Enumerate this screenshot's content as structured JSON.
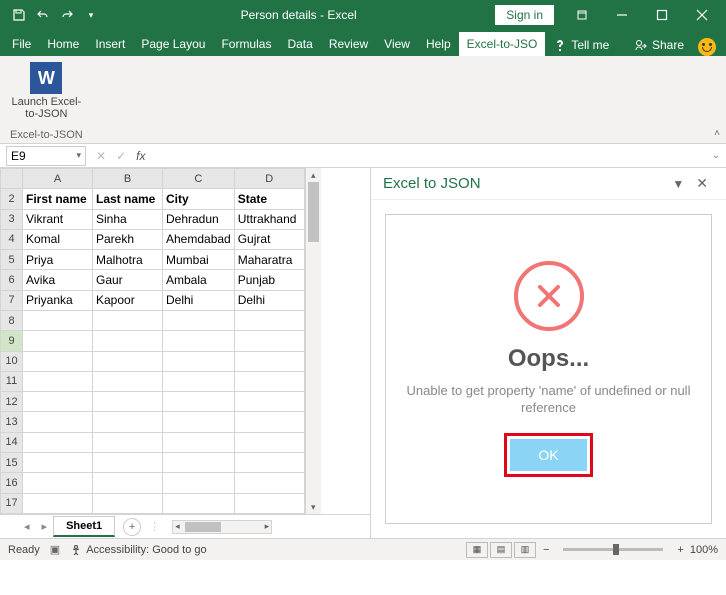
{
  "titlebar": {
    "title": "Person details - Excel",
    "signin": "Sign in"
  },
  "tabs": {
    "file": "File",
    "home": "Home",
    "insert": "Insert",
    "pagelayout": "Page Layou",
    "formulas": "Formulas",
    "data": "Data",
    "review": "Review",
    "view": "View",
    "help": "Help",
    "exceltojson": "Excel-to-JSO",
    "tellme": "Tell me",
    "share": "Share"
  },
  "ribbon": {
    "launch_label": "Launch Excel-\nto-JSON",
    "group_name": "Excel-to-JSON",
    "big_icon_letter": "W"
  },
  "namebox": "E9",
  "sheet": {
    "cols": [
      "A",
      "B",
      "C",
      "D"
    ],
    "rows": [
      "2",
      "3",
      "4",
      "5",
      "6",
      "7",
      "8",
      "9",
      "10",
      "11",
      "12",
      "13",
      "14",
      "15",
      "16",
      "17"
    ],
    "headers": [
      "First name",
      "Last name",
      "City",
      "State"
    ],
    "data": [
      [
        "Vikrant",
        "Sinha",
        "Dehradun",
        "Uttrakhand"
      ],
      [
        "Komal",
        "Parekh",
        "Ahemdabad",
        "Gujrat"
      ],
      [
        "Priya",
        "Malhotra",
        "Mumbai",
        "Maharatra"
      ],
      [
        "Avika",
        "Gaur",
        "Ambala",
        "Punjab"
      ],
      [
        "Priyanka",
        "Kapoor",
        "Delhi",
        "Delhi"
      ]
    ],
    "active_row": "9"
  },
  "taskpane": {
    "title": "Excel to JSON",
    "oops": "Oops...",
    "error": "Unable to get property 'name' of undefined or null reference",
    "ok": "OK"
  },
  "sheettabs": {
    "sheet1": "Sheet1"
  },
  "statusbar": {
    "ready": "Ready",
    "accessibility": "Accessibility: Good to go",
    "zoom": "100%",
    "minus": "−",
    "plus": "+"
  }
}
